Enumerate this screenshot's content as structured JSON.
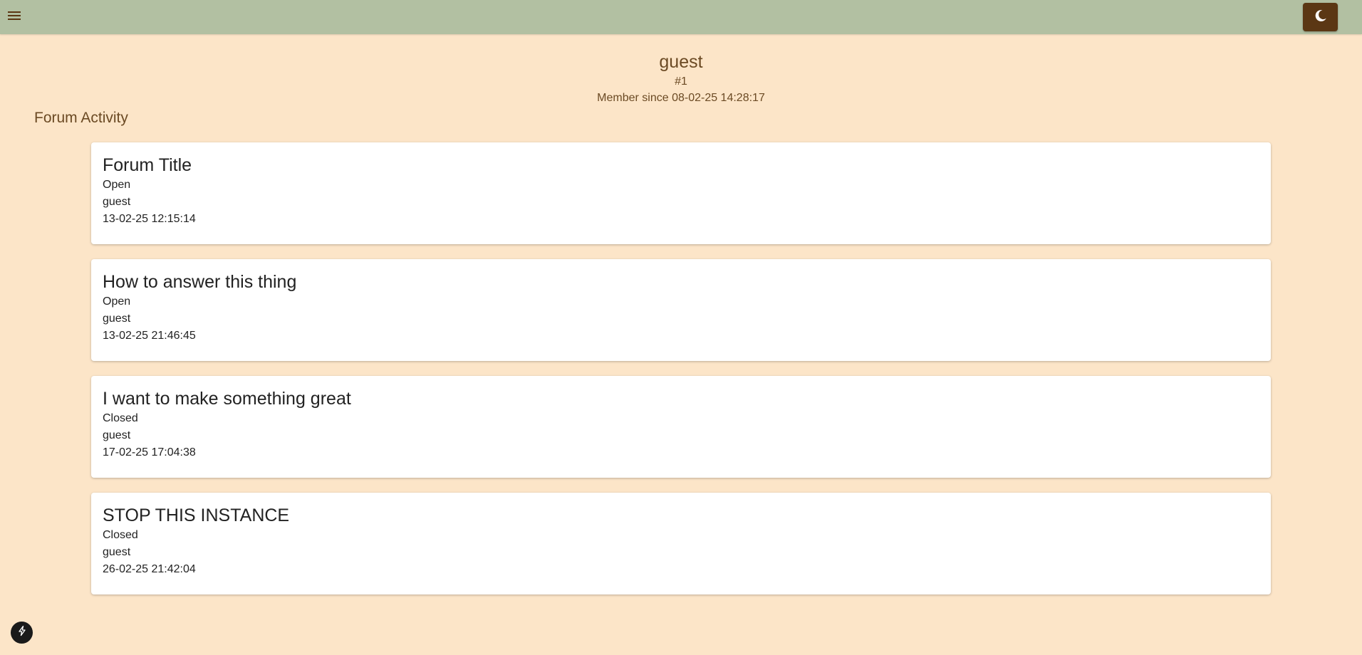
{
  "header": {
    "menu_icon": "hamburger-menu-icon",
    "theme_icon": "moon-icon",
    "colors": {
      "bar": "#b2c0a2",
      "theme_button": "#5b3714",
      "page_background": "#fce5c8",
      "accent_text": "#6b4a24"
    }
  },
  "profile": {
    "username": "guest",
    "user_id": "#1",
    "member_since": "Member since 08-02-25 14:28:17"
  },
  "activity": {
    "heading": "Forum Activity",
    "posts": [
      {
        "title": "Forum Title",
        "status": "Open",
        "author": "guest",
        "timestamp": "13-02-25 12:15:14"
      },
      {
        "title": "How to answer this thing",
        "status": "Open",
        "author": "guest",
        "timestamp": "13-02-25 21:46:45"
      },
      {
        "title": "I want to make something great",
        "status": "Closed",
        "author": "guest",
        "timestamp": "17-02-25 17:04:38"
      },
      {
        "title": "STOP THIS INSTANCE",
        "status": "Closed",
        "author": "guest",
        "timestamp": "26-02-25 21:42:04"
      }
    ]
  },
  "floating_button": {
    "icon": "lightning-bolt-icon"
  }
}
